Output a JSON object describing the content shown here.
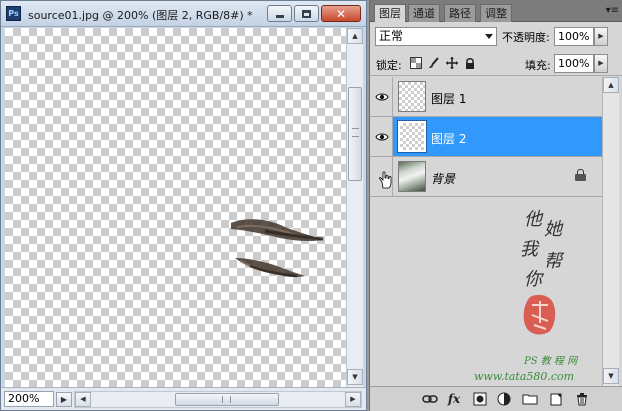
{
  "document": {
    "app_icon": "Ps",
    "title": "source01.jpg @ 200% (图层 2, RGB/8#) *",
    "zoom": "200%"
  },
  "panel": {
    "tabs": [
      "图层",
      "通道",
      "路径",
      "调整"
    ],
    "active_tab": 0,
    "blend_mode": "正常",
    "opacity_label": "不透明度:",
    "opacity_value": "100%",
    "lock_label": "锁定:",
    "fill_label": "填充:",
    "fill_value": "100%",
    "layers": [
      {
        "name": "图层 1",
        "visible": true,
        "selected": false,
        "thumb": "transparent"
      },
      {
        "name": "图层 2",
        "visible": true,
        "selected": true,
        "thumb": "transparent"
      },
      {
        "name": "背景",
        "visible": false,
        "selected": false,
        "thumb": "photo",
        "locked": true
      }
    ],
    "bottom_buttons": [
      "link-icon",
      "fx-icon",
      "mask-icon",
      "adjustment-icon",
      "folder-icon",
      "new-layer-icon",
      "trash-icon"
    ],
    "fx_label": "fx"
  },
  "watermark": {
    "chars": [
      "他",
      "她",
      "我",
      "帮",
      "你"
    ],
    "site1": "PS 教 程 网",
    "site2": "www.tata580.com"
  },
  "colors": {
    "selection": "#3199fb",
    "titlebar": "#c9d6e6"
  }
}
